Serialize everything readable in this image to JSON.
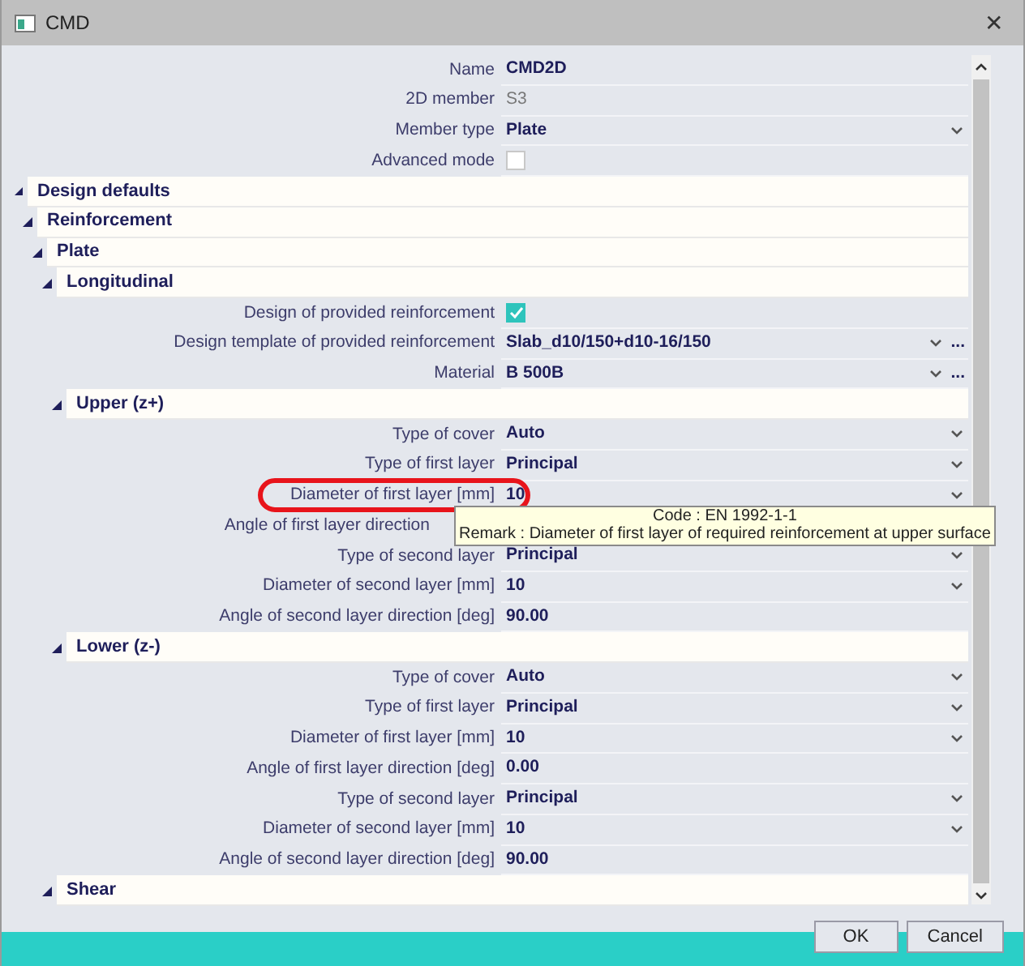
{
  "window": {
    "title": "CMD",
    "close": "✕"
  },
  "properties": [
    {
      "kind": "text",
      "label": "Name",
      "value": "CMD2D"
    },
    {
      "kind": "readonly",
      "label": "2D member",
      "value": "S3"
    },
    {
      "kind": "dropdown",
      "label": "Member type",
      "value": "Plate"
    },
    {
      "kind": "checkbox",
      "label": "Advanced mode",
      "checked": false
    }
  ],
  "groups": [
    {
      "title": "Design defaults",
      "expanded": true,
      "children": [
        {
          "title": "Reinforcement",
          "expanded": true,
          "children": [
            {
              "title": "Plate",
              "expanded": true,
              "children": [
                {
                  "title": "Longitudinal",
                  "expanded": true,
                  "rows": [
                    {
                      "kind": "checkbox",
                      "label": "Design of provided reinforcement",
                      "checked": true
                    },
                    {
                      "kind": "dropdown",
                      "label": "Design template of provided reinforcement",
                      "value": "Slab_d10/150+d10-16/150",
                      "button": "..."
                    },
                    {
                      "kind": "dropdown",
                      "label": "Material",
                      "value": "B 500B",
                      "button": "..."
                    }
                  ],
                  "children": [
                    {
                      "title": "Upper (z+)",
                      "expanded": true,
                      "rows": [
                        {
                          "kind": "dropdown",
                          "label": "Type of cover",
                          "value": "Auto"
                        },
                        {
                          "kind": "dropdown",
                          "label": "Type of first layer",
                          "value": "Principal"
                        },
                        {
                          "kind": "dropdown",
                          "label": "Diameter of first layer [mm]",
                          "value": "10",
                          "highlighted": true,
                          "tooltip": {
                            "code": "Code : EN 1992-1-1",
                            "remark": "Remark : Diameter of first layer of required reinforcement at upper surface"
                          }
                        },
                        {
                          "kind": "covered",
                          "label": "Angle of first layer direction"
                        },
                        {
                          "kind": "dropdown",
                          "label": "Type of second layer",
                          "value": "Principal"
                        },
                        {
                          "kind": "dropdown",
                          "label": "Diameter of second layer [mm]",
                          "value": "10"
                        },
                        {
                          "kind": "text",
                          "label": "Angle of second layer direction [deg]",
                          "value": "90.00"
                        }
                      ]
                    },
                    {
                      "title": "Lower (z-)",
                      "expanded": true,
                      "rows": [
                        {
                          "kind": "dropdown",
                          "label": "Type of cover",
                          "value": "Auto"
                        },
                        {
                          "kind": "dropdown",
                          "label": "Type of first layer",
                          "value": "Principal"
                        },
                        {
                          "kind": "dropdown",
                          "label": "Diameter of first layer [mm]",
                          "value": "10"
                        },
                        {
                          "kind": "text",
                          "label": "Angle of first layer direction [deg]",
                          "value": "0.00"
                        },
                        {
                          "kind": "dropdown",
                          "label": "Type of second layer",
                          "value": "Principal"
                        },
                        {
                          "kind": "dropdown",
                          "label": "Diameter of second layer [mm]",
                          "value": "10"
                        },
                        {
                          "kind": "text",
                          "label": "Angle of second layer direction [deg]",
                          "value": "90.00"
                        }
                      ]
                    }
                  ]
                },
                {
                  "title": "Shear",
                  "expanded": true
                }
              ]
            }
          ]
        }
      ]
    }
  ],
  "buttons": [
    "OK",
    "Cancel"
  ]
}
